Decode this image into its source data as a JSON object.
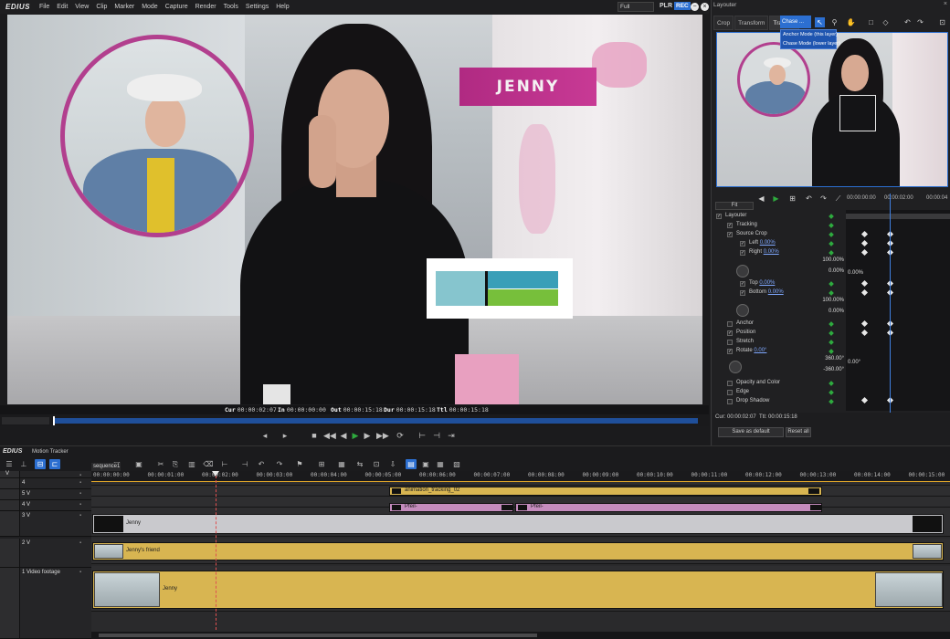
{
  "app": {
    "logo": "EDIUS",
    "menu": [
      "File",
      "Edit",
      "View",
      "Clip",
      "Marker",
      "Mode",
      "Capture",
      "Render",
      "Tools",
      "Settings",
      "Help"
    ]
  },
  "player": {
    "quality": "Full",
    "plr": "PLR",
    "rec": "REC",
    "name_plate": "JENNY",
    "timecodes": [
      {
        "k": "Cur",
        "v": "00:00:02:07"
      },
      {
        "k": "In",
        "v": "00:00:00:00"
      },
      {
        "k": "Out",
        "v": "00:00:15:18"
      },
      {
        "k": "Dur",
        "v": "00:00:15:18"
      },
      {
        "k": "Ttl",
        "v": "00:00:15:18"
      }
    ]
  },
  "layouter": {
    "title": "Layouter",
    "tabs": [
      "Crop",
      "Transform",
      "Tracking"
    ],
    "mode_select": "Chase ...",
    "mode_menu": [
      "Anchor Mode (this layer)",
      "Chase Mode (lower layer)"
    ],
    "fit": "Fit",
    "ruler": [
      "00:00:00:00",
      "00:00:02:00",
      "00:00:04"
    ],
    "rows": [
      {
        "label": "Layouter",
        "value": ""
      },
      {
        "label": "Tracking",
        "value": ""
      },
      {
        "label": "Source Crop",
        "value": ""
      },
      {
        "label": "Left",
        "value": "0.00%"
      },
      {
        "label": "Right",
        "value": "0.00%"
      },
      {
        "label": "Top",
        "value": "0.00%"
      },
      {
        "label": "Bottom",
        "value": "0.00%"
      },
      {
        "label": "Anchor",
        "value": ""
      },
      {
        "label": "Position",
        "value": ""
      },
      {
        "label": "Stretch",
        "value": ""
      },
      {
        "label": "Rotate",
        "value": "0.00°"
      },
      {
        "label": "Opacity and Color",
        "value": ""
      },
      {
        "label": "Edge",
        "value": ""
      },
      {
        "label": "Drop Shadow",
        "value": ""
      }
    ],
    "graph_values": {
      "a_max": "100.00%",
      "a_min": "0.00%",
      "a_mid": "0.00%",
      "b_max": "100.00%",
      "b_min": "0.00%",
      "r_max": "360.00°",
      "r_mid": "0.00°",
      "r_min": "-360.00°"
    },
    "cur": "Cur: 00:00:02:07",
    "ttl": "Ttl: 00:00:15:18",
    "save_default": "Save as default",
    "reset_all": "Reset all"
  },
  "timeline": {
    "logo": "EDIUS",
    "name": "Motion Tracker",
    "sequence_tab": "sequence1",
    "ruler": [
      "00:00:00:00",
      "00:00:01:00",
      "00:00:02:00",
      "00:00:03:00",
      "00:00:04:00",
      "00:00:05:00",
      "00:00:06:00",
      "00:00:07:00",
      "00:00:08:00",
      "00:00:09:00",
      "00:00:10:00",
      "00:00:11:00",
      "00:00:12:00",
      "00:00:13:00",
      "00:00:14:00",
      "00:00:15:00"
    ],
    "tracks": [
      "V",
      "4",
      "5 V",
      "4 V",
      "3 V",
      "2 V",
      "1 Video footage"
    ],
    "clips": {
      "animation": "animation_tracking_02",
      "arrow1": "Pfeil-",
      "arrow2": "Pfeil-",
      "jenny_title": "Jenny",
      "friend": "Jenny's friend",
      "footage": "Jenny"
    }
  }
}
